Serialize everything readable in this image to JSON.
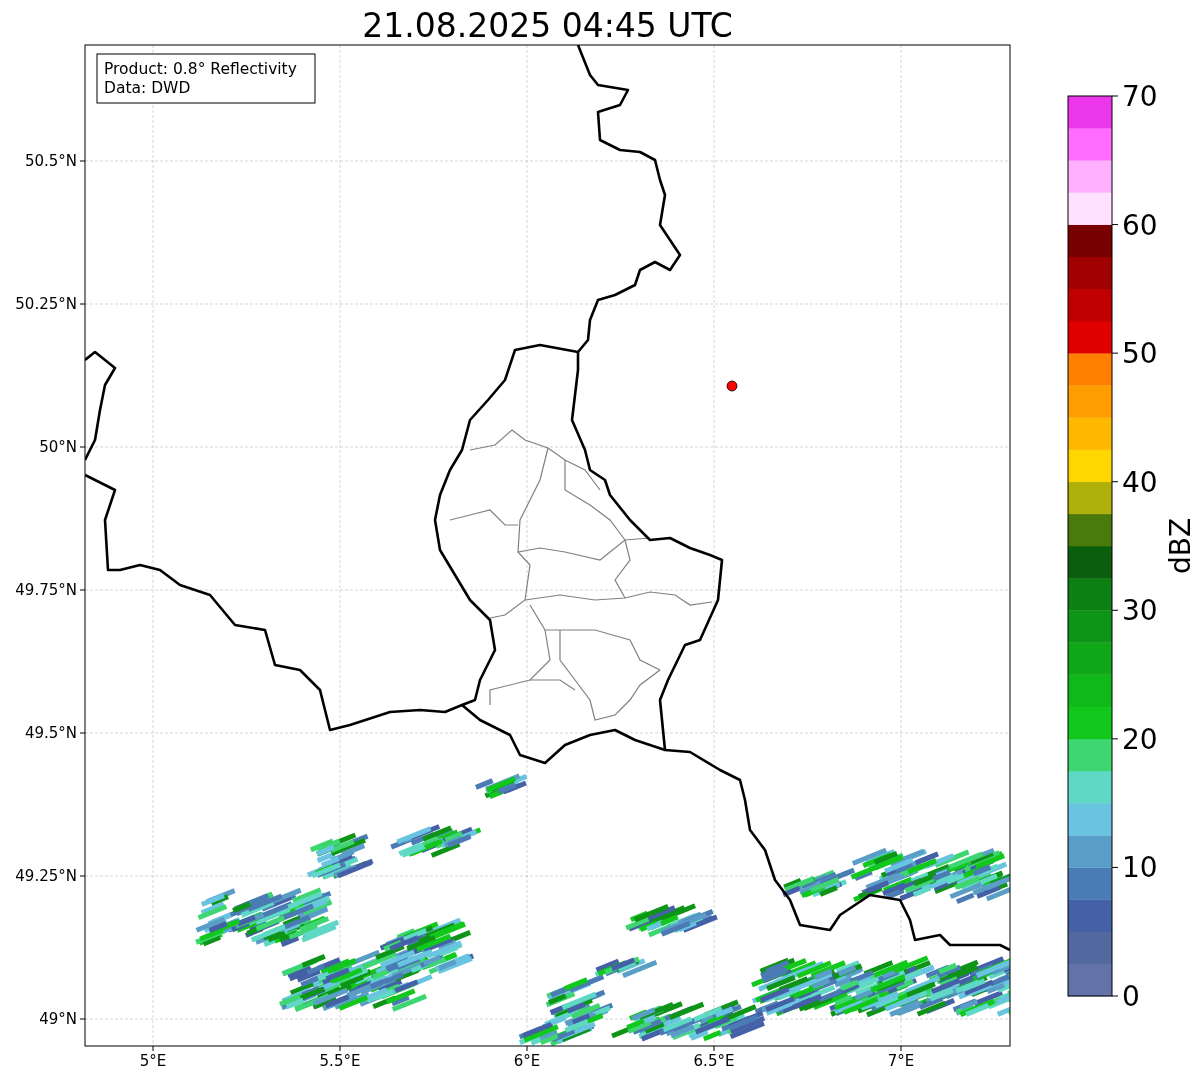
{
  "title": "21.08.2025 04:45 UTC",
  "info_box": [
    "Product: 0.8° Reflectivity",
    "Data: DWD"
  ],
  "map": {
    "x_ticks": [
      "5°E",
      "5.5°E",
      "6°E",
      "6.5°E",
      "7°E"
    ],
    "y_ticks": [
      "50.5°N",
      "50.25°N",
      "50°N",
      "49.75°N",
      "49.5°N",
      "49.25°N",
      "49°N"
    ]
  },
  "colorbar": {
    "label": "dBZ",
    "ticks": [
      "70",
      "60",
      "50",
      "40",
      "30",
      "20",
      "10",
      "0"
    ],
    "segments": [
      {
        "color": "#6373a8"
      },
      {
        "color": "#5468a0"
      },
      {
        "color": "#4460a6"
      },
      {
        "color": "#4b7bb5"
      },
      {
        "color": "#5a9ec8"
      },
      {
        "color": "#68c4e0"
      },
      {
        "color": "#5fd8c6"
      },
      {
        "color": "#3dd670"
      },
      {
        "color": "#12c81c"
      },
      {
        "color": "#10b81a"
      },
      {
        "color": "#10a818"
      },
      {
        "color": "#0e9416"
      },
      {
        "color": "#0c8012"
      },
      {
        "color": "#0a5e0c"
      },
      {
        "color": "#4a7a0c"
      },
      {
        "color": "#b0b00a"
      },
      {
        "color": "#ffd700"
      },
      {
        "color": "#ffb800"
      },
      {
        "color": "#ff9c00"
      },
      {
        "color": "#ff8000"
      },
      {
        "color": "#e00000"
      },
      {
        "color": "#c00000"
      },
      {
        "color": "#a00000"
      },
      {
        "color": "#780000"
      },
      {
        "color": "#ffe0ff"
      },
      {
        "color": "#ffb0ff"
      },
      {
        "color": "#ff6cff"
      },
      {
        "color": "#ec36ec"
      }
    ]
  }
}
